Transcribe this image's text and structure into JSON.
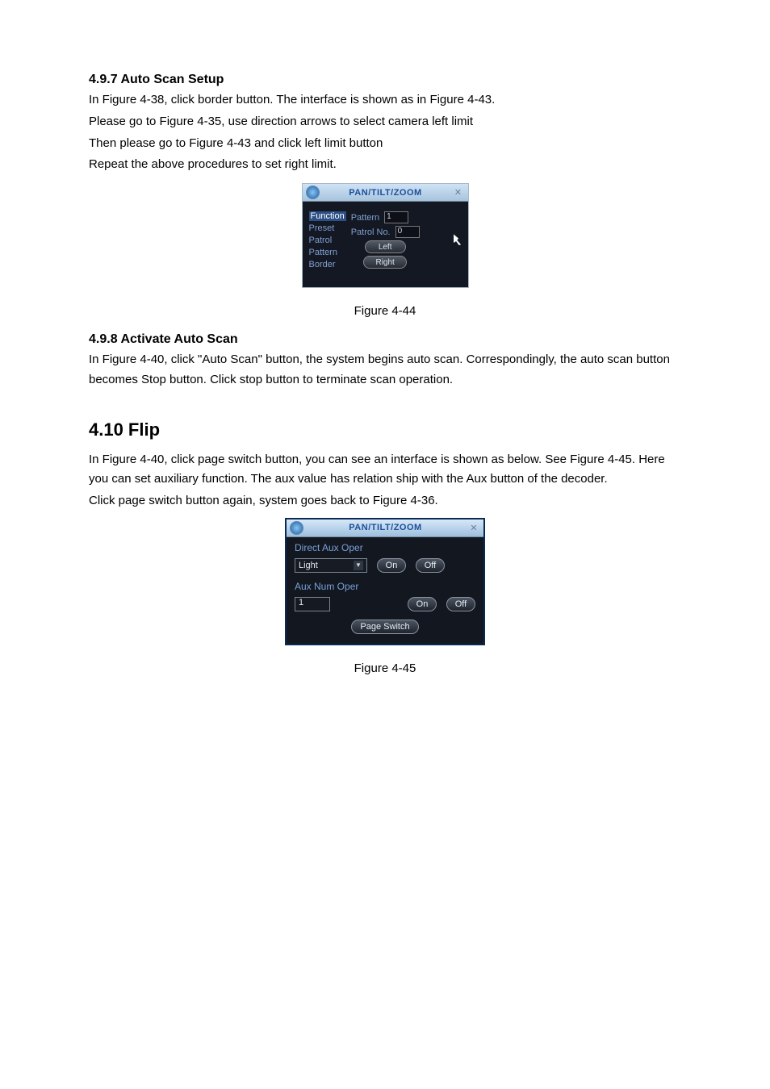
{
  "s1": {
    "heading": "4.9.7 Auto Scan Setup",
    "p1": "In  Figure 4-38, click border button. The interface is shown as in  Figure 4-43.",
    "p2": "Please go to  Figure 4-35, use direction arrows to select camera left limit",
    "p3": "Then please go to  Figure 4-43 and click left limit button",
    "p4": "Repeat the above procedures to set right limit."
  },
  "dlg1": {
    "title": "PAN/TILT/ZOOM",
    "func_head": "Function",
    "items": {
      "preset": "Preset",
      "patrol": "Patrol",
      "pattern": "Pattern",
      "border": "Border"
    },
    "labels": {
      "pattern": "Pattern",
      "patrolno": "Patrol No."
    },
    "values": {
      "pattern": "1",
      "patrolno": "0"
    },
    "buttons": {
      "left": "Left",
      "right": "Right"
    }
  },
  "fig1": "Figure 4-44",
  "s2": {
    "heading": "4.9.8 Activate Auto Scan",
    "p1": "In Figure 4-40, click \"Auto Scan\" button, the system begins auto scan. Correspondingly, the auto scan button becomes Stop button. Click stop button to terminate scan operation."
  },
  "s3": {
    "heading": "4.10 Flip",
    "p1": "In Figure 4-40, click page switch button, you can see an interface is shown as below. See Figure 4-45. Here you can set auxiliary function. The aux value has relation ship with the Aux button of the decoder.",
    "p2": "Click page switch button again, system goes back to Figure 4-36."
  },
  "dlg2": {
    "title": "PAN/TILT/ZOOM",
    "section1": "Direct Aux Oper",
    "select_value": "Light",
    "on": "On",
    "off": "Off",
    "section2": "Aux Num Oper",
    "num_value": "1",
    "page_switch": "Page Switch"
  },
  "fig2": "Figure 4-45"
}
